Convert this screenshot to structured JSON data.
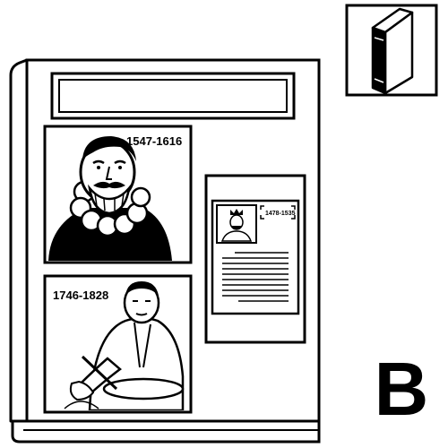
{
  "book": {
    "portrait_top": {
      "years": "1547-1616"
    },
    "portrait_bottom": {
      "years": "1746-1828"
    },
    "document": {
      "years": "1478-1535"
    }
  },
  "corner_letter": "B",
  "icons": [
    "book-icon"
  ]
}
